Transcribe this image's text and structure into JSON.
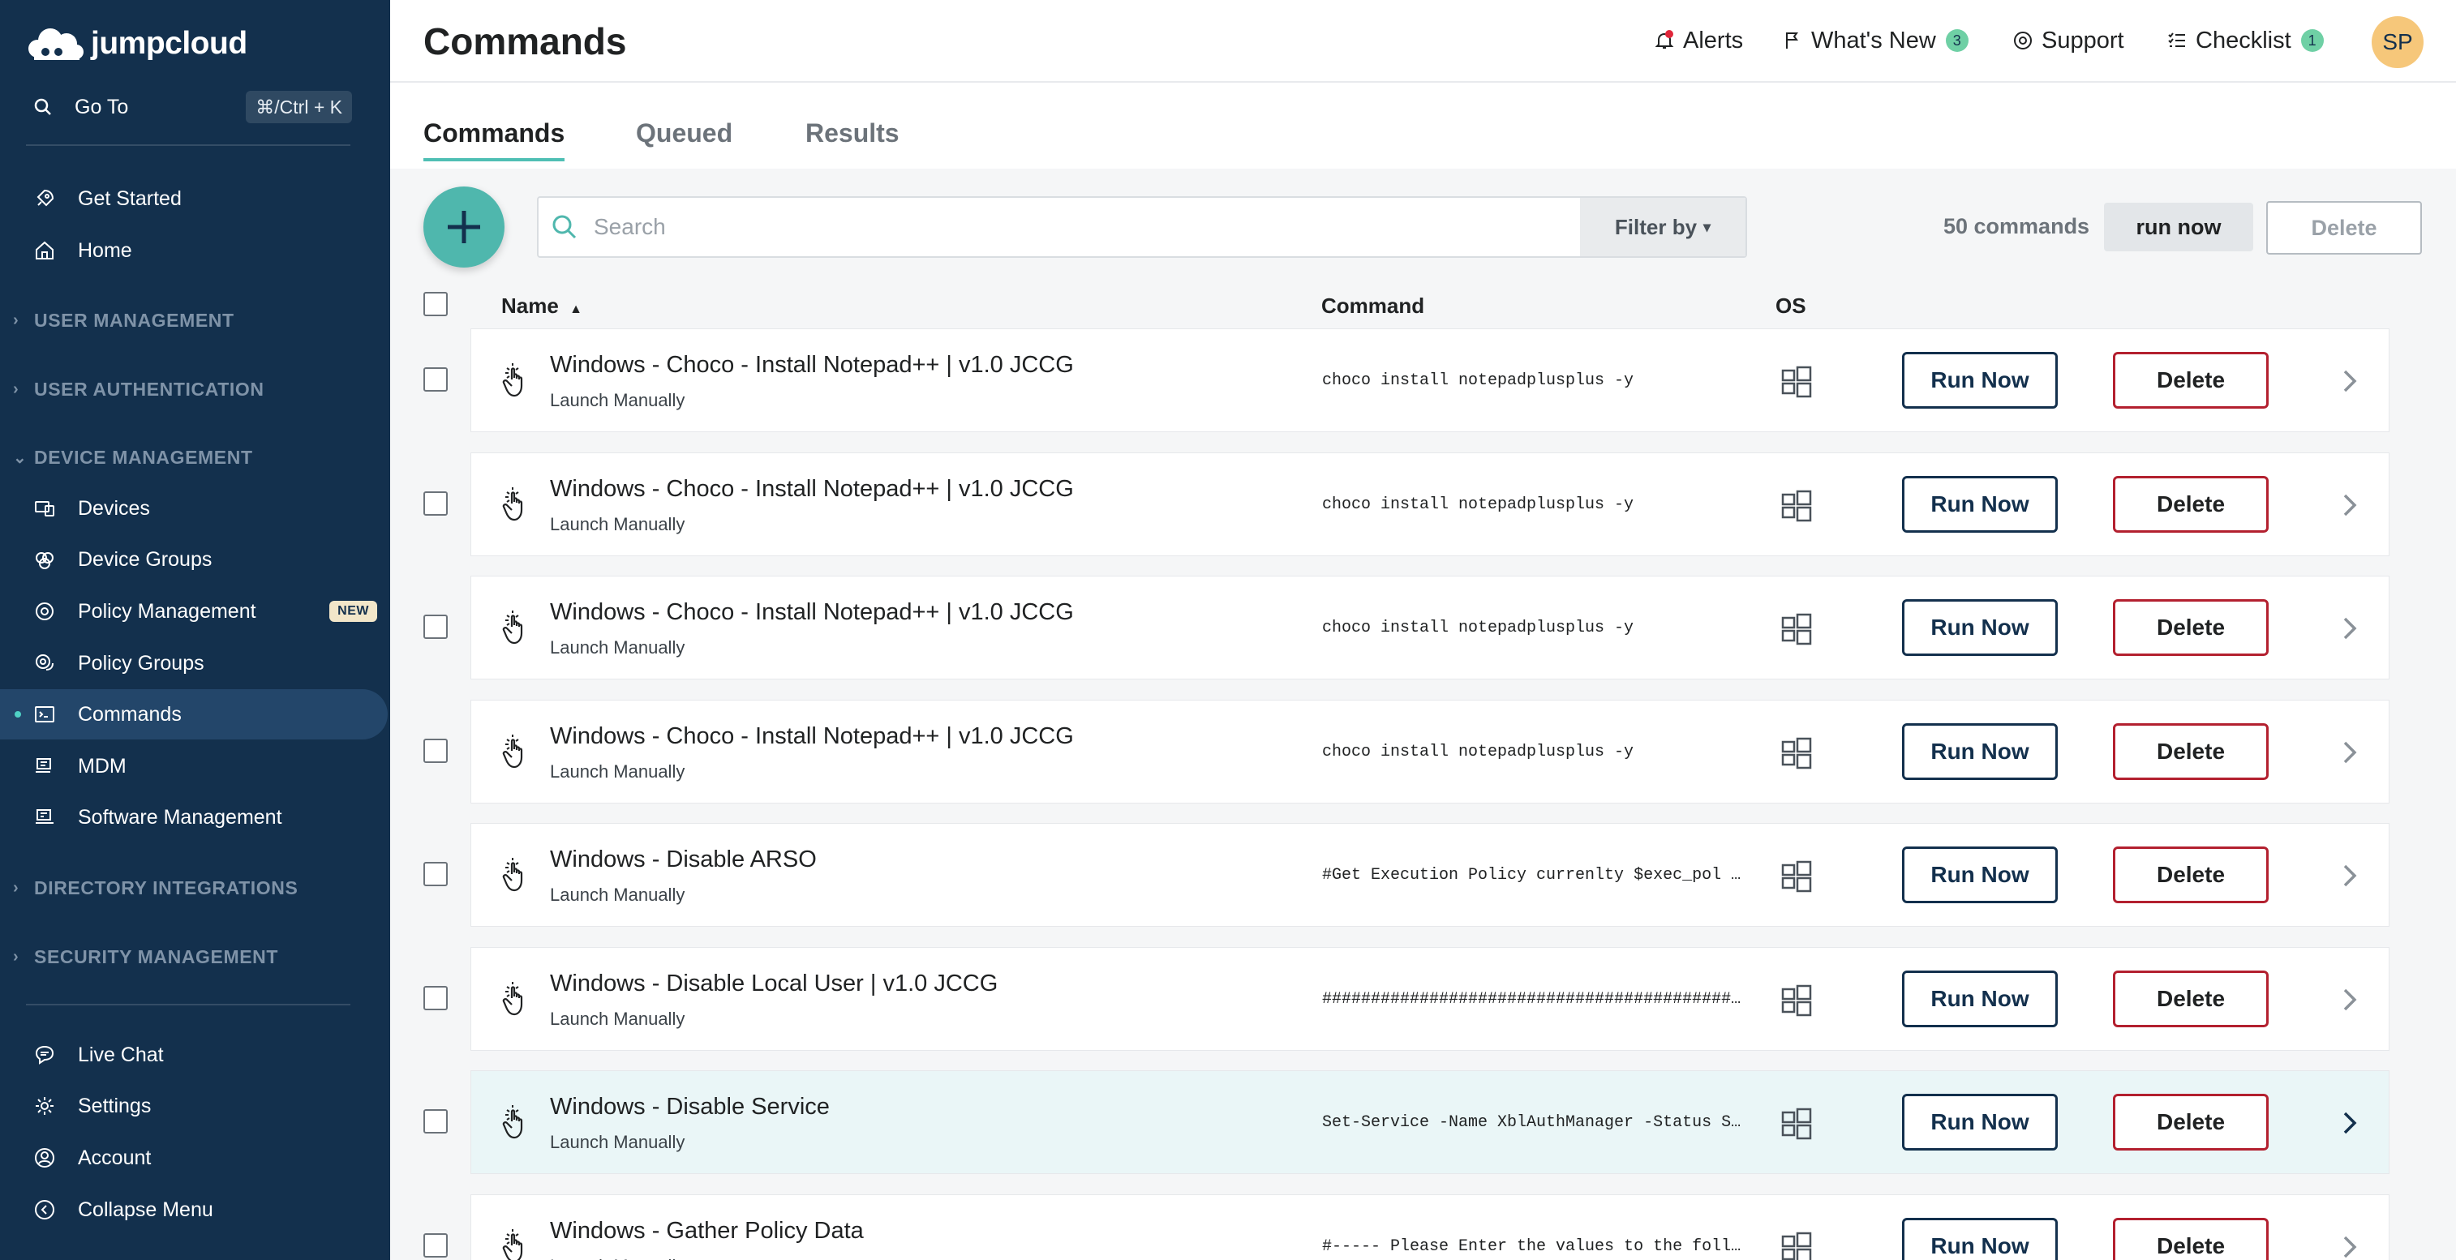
{
  "app": {
    "logo_text": "jumpcloud"
  },
  "sidebar": {
    "goto_label": "Go To",
    "goto_shortcut": "⌘/Ctrl + K",
    "top_items": [
      {
        "label": "Get Started",
        "icon": "rocket-icon"
      },
      {
        "label": "Home",
        "icon": "home-icon"
      }
    ],
    "sections": [
      {
        "label": "USER MANAGEMENT",
        "expanded": false
      },
      {
        "label": "USER AUTHENTICATION",
        "expanded": false
      },
      {
        "label": "DEVICE MANAGEMENT",
        "expanded": true
      },
      {
        "label": "DIRECTORY INTEGRATIONS",
        "expanded": false
      },
      {
        "label": "SECURITY MANAGEMENT",
        "expanded": false
      }
    ],
    "device_items": [
      {
        "label": "Devices",
        "icon": "devices-icon"
      },
      {
        "label": "Device Groups",
        "icon": "device-groups-icon"
      },
      {
        "label": "Policy Management",
        "icon": "policy-icon",
        "badge": "NEW"
      },
      {
        "label": "Policy Groups",
        "icon": "policy-groups-icon"
      },
      {
        "label": "Commands",
        "icon": "terminal-icon",
        "active": true
      },
      {
        "label": "MDM",
        "icon": "mdm-icon"
      },
      {
        "label": "Software Management",
        "icon": "software-icon"
      }
    ],
    "bottom_items": [
      {
        "label": "Live Chat",
        "icon": "chat-icon"
      },
      {
        "label": "Settings",
        "icon": "gear-icon"
      },
      {
        "label": "Account",
        "icon": "account-icon"
      },
      {
        "label": "Collapse Menu",
        "icon": "collapse-icon"
      }
    ]
  },
  "header": {
    "title": "Commands",
    "alerts_label": "Alerts",
    "whats_new_label": "What's New",
    "whats_new_count": "3",
    "support_label": "Support",
    "checklist_label": "Checklist",
    "checklist_count": "1",
    "avatar_initials": "SP"
  },
  "tabs": [
    {
      "label": "Commands",
      "active": true
    },
    {
      "label": "Queued",
      "active": false
    },
    {
      "label": "Results",
      "active": false
    }
  ],
  "toolbar": {
    "search_placeholder": "Search",
    "filter_label": "Filter by",
    "count_label": "50 commands",
    "run_now_label": "run now",
    "delete_label": "Delete"
  },
  "table": {
    "columns": {
      "name": "Name",
      "command": "Command",
      "os": "OS"
    },
    "sort": {
      "column": "Name",
      "direction": "ascending"
    },
    "run_label": "Run Now",
    "delete_label": "Delete",
    "rows": [
      {
        "name": "Windows - Choco - Install Notepad++ | v1.0 JCCG",
        "trigger": "Launch Manually",
        "command": "choco install notepadplusplus -y",
        "os": "windows-icon"
      },
      {
        "name": "Windows - Choco - Install Notepad++ | v1.0 JCCG",
        "trigger": "Launch Manually",
        "command": "choco install notepadplusplus -y",
        "os": "windows-icon"
      },
      {
        "name": "Windows - Choco - Install Notepad++ | v1.0 JCCG",
        "trigger": "Launch Manually",
        "command": "choco install notepadplusplus -y",
        "os": "windows-icon"
      },
      {
        "name": "Windows - Choco - Install Notepad++ | v1.0 JCCG",
        "trigger": "Launch Manually",
        "command": "choco install notepadplusplus -y",
        "os": "windows-icon"
      },
      {
        "name": "Windows - Disable ARSO",
        "trigger": "Launch Manually",
        "command": "#Get Execution Policy currenlty $exec_pol …",
        "os": "windows-icon"
      },
      {
        "name": "Windows - Disable Local User | v1.0 JCCG",
        "trigger": "Launch Manually",
        "command": "##############################################…",
        "os": "windows-icon"
      },
      {
        "name": "Windows - Disable Service",
        "trigger": "Launch Manually",
        "command": "Set-Service -Name XblAuthManager -Status S…",
        "os": "windows-icon",
        "hover": true
      },
      {
        "name": "Windows - Gather Policy Data",
        "trigger": "Launch Manually",
        "command": "#----- Please Enter the values to the foll…",
        "os": "windows-icon"
      }
    ]
  },
  "colors": {
    "sidebar_bg": "#13304d",
    "accent": "#4fb7ad",
    "danger": "#b3202f",
    "hover_row": "#eaf6f7"
  }
}
